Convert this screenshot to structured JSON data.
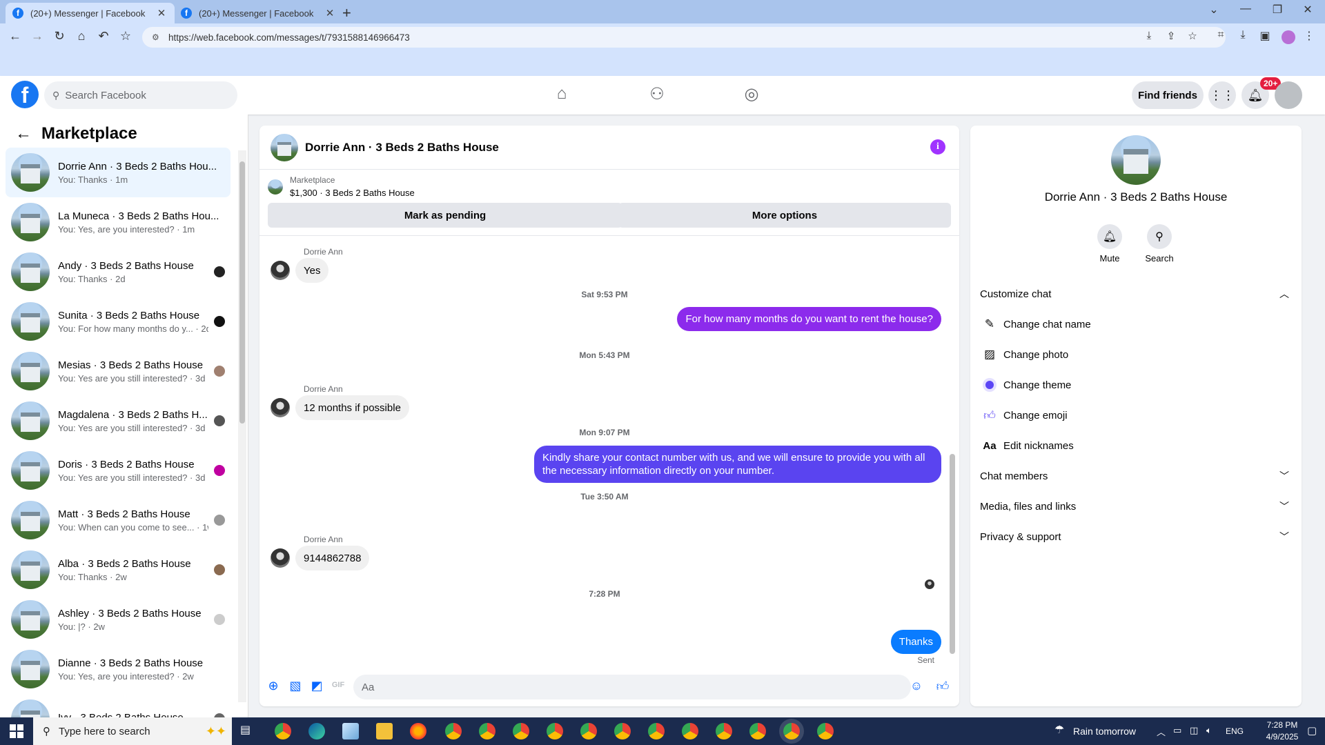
{
  "browser": {
    "tabs": [
      {
        "title": "(20+) Messenger | Facebook",
        "active": true
      },
      {
        "title": "(20+) Messenger | Facebook",
        "active": false
      }
    ],
    "url": "https://web.facebook.com/messages/t/7931588146966473"
  },
  "header": {
    "search_placeholder": "Search Facebook",
    "find_friends": "Find friends",
    "notification_count": "20+"
  },
  "sidebar": {
    "title": "Marketplace",
    "conversations": [
      {
        "name": "Dorrie Ann · 3 Beds 2 Baths Hou...",
        "preview": "You: Thanks · 1m",
        "active": true
      },
      {
        "name": "La Muneca · 3 Beds 2 Baths Hou...",
        "preview": "You: Yes, are you interested? · 1m"
      },
      {
        "name": "Andy · 3 Beds 2 Baths House",
        "preview": "You: Thanks · 2d"
      },
      {
        "name": "Sunita · 3 Beds 2 Baths House",
        "preview": "You: For how many months do y... · 2d"
      },
      {
        "name": "Mesias · 3 Beds 2 Baths House",
        "preview": "You: Yes are you still interested? · 3d"
      },
      {
        "name": "Magdalena · 3 Beds 2 Baths H...",
        "preview": "You: Yes are you still interested? · 3d"
      },
      {
        "name": "Doris · 3 Beds 2 Baths House",
        "preview": "You: Yes are you still interested? · 3d"
      },
      {
        "name": "Matt · 3 Beds 2 Baths House",
        "preview": "You: When can you come to see... · 1w"
      },
      {
        "name": "Alba · 3 Beds 2 Baths House",
        "preview": "You: Thanks · 2w"
      },
      {
        "name": "Ashley · 3 Beds 2 Baths House",
        "preview": "You: |? · 2w"
      },
      {
        "name": "Dianne · 3 Beds 2 Baths House",
        "preview": "You: Yes, are you interested? · 2w"
      },
      {
        "name": "Ivy · 3 Beds 2 Baths House",
        "preview": ""
      }
    ]
  },
  "chat": {
    "title": "Dorrie Ann · 3 Beds 2 Baths House",
    "marketplace_label": "Marketplace",
    "listing": "$1,300 · 3 Beds 2 Baths House",
    "mark_pending": "Mark as pending",
    "more_options": "More options",
    "messages": {
      "m1_sender": "Dorrie Ann",
      "m1_text": "Yes",
      "t1": "Sat 9:53 PM",
      "m2_text": "For how many months do you want to rent the house?",
      "t2": "Mon 5:43 PM",
      "m3_sender": "Dorrie Ann",
      "m3_text": "12 months if possible",
      "t3": "Mon 9:07 PM",
      "m4_text": "Kindly share your contact number with us, and we will ensure to provide you with all the necessary information directly on your number.",
      "t4": "Tue 3:50 AM",
      "m5_sender": "Dorrie Ann",
      "m5_text": "9144862788",
      "t5": "7:28 PM",
      "m6_text": "Thanks",
      "status": "Sent"
    },
    "composer_placeholder": "Aa"
  },
  "info_panel": {
    "name": "Dorrie Ann · 3 Beds 2 Baths House",
    "mute": "Mute",
    "search": "Search",
    "customize_chat": "Customize chat",
    "change_chat_name": "Change chat name",
    "change_photo": "Change photo",
    "change_theme": "Change theme",
    "change_emoji": "Change emoji",
    "edit_nicknames": "Edit nicknames",
    "chat_members": "Chat members",
    "media_files_links": "Media, files and links",
    "privacy_support": "Privacy & support"
  },
  "taskbar": {
    "search_placeholder": "Type here to search",
    "weather": "Rain tomorrow",
    "language": "ENG",
    "time": "7:28 PM",
    "date": "4/9/2025"
  },
  "colors": {
    "facebook_blue": "#1877f2",
    "messenger_purple": "#8a2be2",
    "messenger_blue": "#0a7cff",
    "theme_purple": "#a033ff"
  }
}
